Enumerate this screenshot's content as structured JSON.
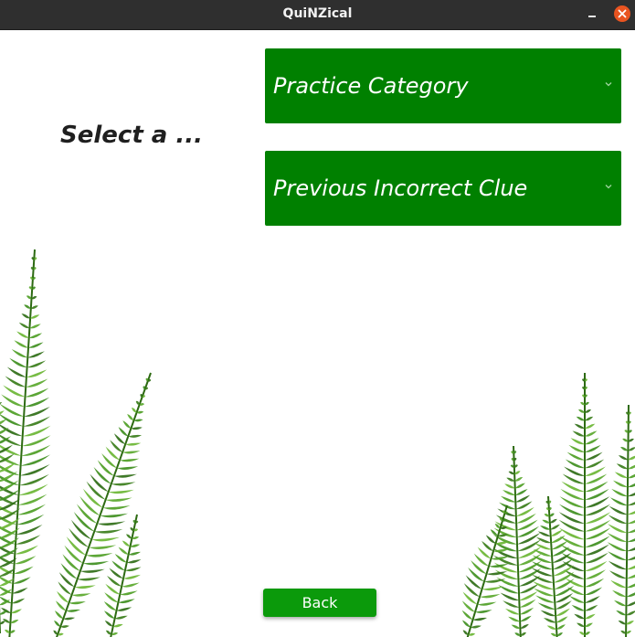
{
  "window": {
    "title": "QuiNZical"
  },
  "main": {
    "prompt_label": "Select a ...",
    "options": [
      {
        "label": "Practice Category"
      },
      {
        "label": "Previous Incorrect Clue"
      }
    ],
    "back_label": "Back"
  },
  "colors": {
    "option_green": "#008000",
    "back_button_green": "#0b9a0b",
    "close_orange": "#e95420",
    "titlebar": "#2f2f2f"
  },
  "icons": {
    "dropdown": "chevron-down-icon",
    "close": "close-icon",
    "minimize": "minimize-icon",
    "decoration": "fern-icon"
  }
}
